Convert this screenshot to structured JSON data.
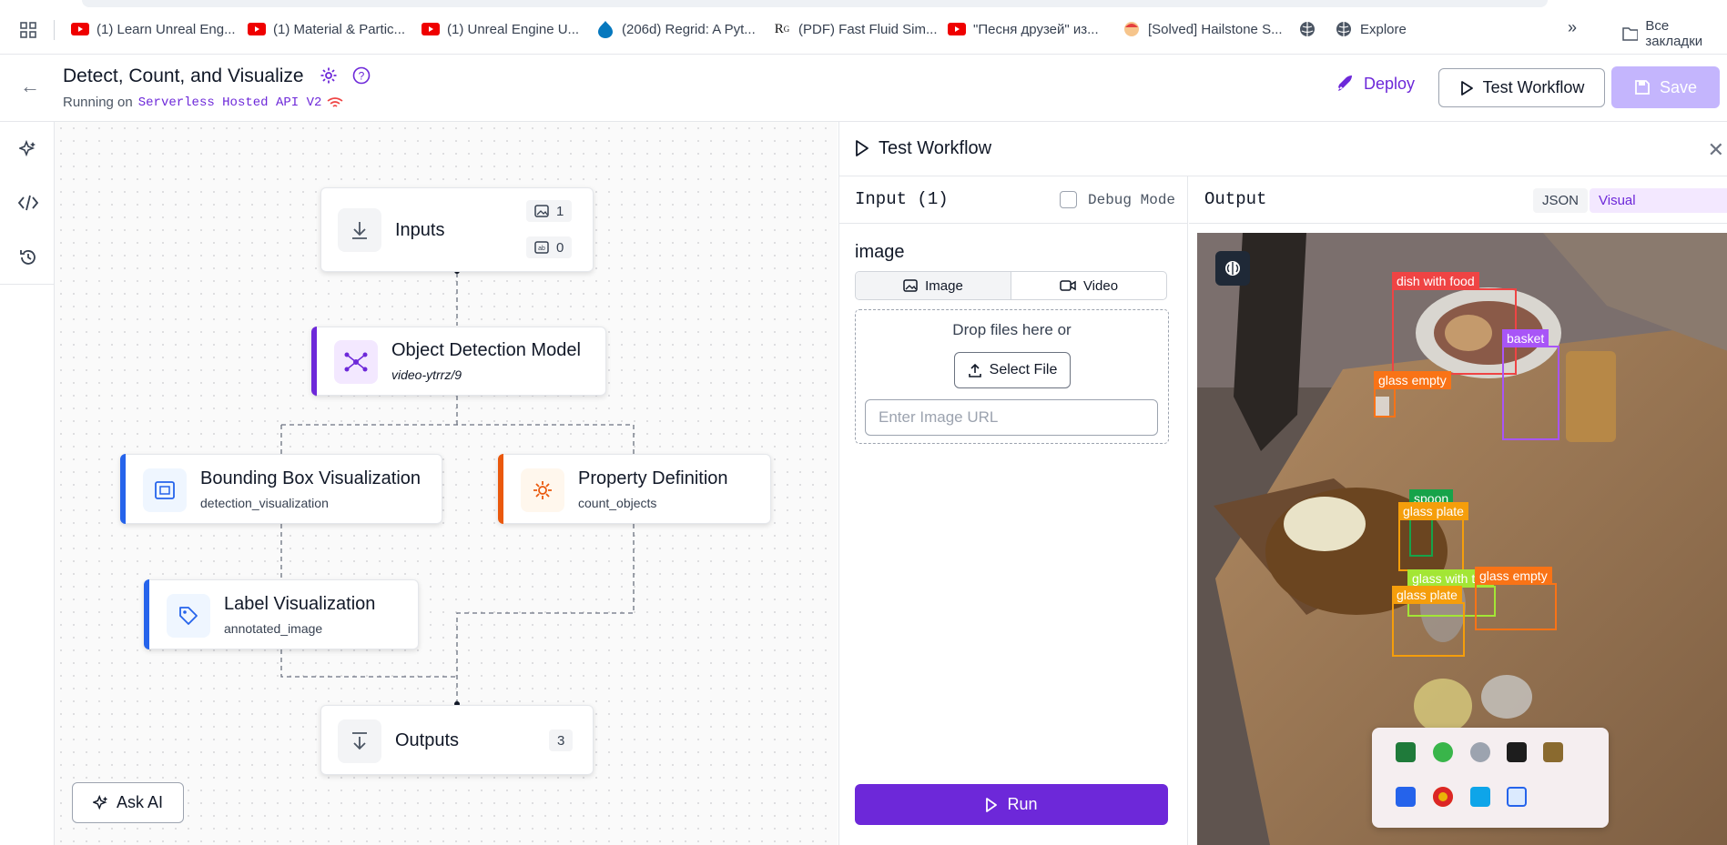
{
  "bookmarks": [
    {
      "label": "(1) Learn Unreal Eng...",
      "icon": "youtube-icon"
    },
    {
      "label": "(1) Material & Partic...",
      "icon": "youtube-icon"
    },
    {
      "label": "(1) Unreal Engine U...",
      "icon": "youtube-icon"
    },
    {
      "label": "(206d) Regrid: A Pyt...",
      "icon": "drupal-icon"
    },
    {
      "label": "(PDF) Fast Fluid Sim...",
      "icon": "researchgate-icon"
    },
    {
      "label": "\"Песня друзей\" из...",
      "icon": "youtube-icon"
    },
    {
      "label": "[Solved] Hailstone S...",
      "icon": "avatar-icon"
    },
    {
      "label": "",
      "icon": "globe-icon"
    },
    {
      "label": "Explore",
      "icon": "globe-icon"
    }
  ],
  "bookmarks_more": "»",
  "bookmarks_folder": "Все закладки",
  "header": {
    "title": "Detect, Count, and Visualize",
    "running_prefix": "Running on",
    "running_target": "Serverless Hosted API V2",
    "deploy_label": "Deploy",
    "test_label": "Test Workflow",
    "save_label": "Save"
  },
  "nodes": {
    "inputs": {
      "title": "Inputs",
      "image_count": "1",
      "param_count": "0"
    },
    "detection": {
      "title": "Object Detection Model",
      "subtitle": "video-ytrrz/9",
      "accent": "#6d28d9"
    },
    "bbox": {
      "title": "Bounding Box Visualization",
      "subtitle": "detection_visualization",
      "accent": "#2563eb"
    },
    "property": {
      "title": "Property Definition",
      "subtitle": "count_objects",
      "accent": "#ea580c"
    },
    "label": {
      "title": "Label Visualization",
      "subtitle": "annotated_image",
      "accent": "#2563eb"
    },
    "outputs": {
      "title": "Outputs",
      "count": "3"
    }
  },
  "ask_ai_label": "Ask AI",
  "test_panel": {
    "title": "Test Workflow",
    "input_header": "Input (1)",
    "debug_label": "Debug Mode",
    "debug_checked": false,
    "field_name": "image",
    "tabs": [
      "Image",
      "Video"
    ],
    "active_tab": "Image",
    "drop_text": "Drop files here or",
    "select_file_label": "Select File",
    "url_placeholder": "Enter Image URL",
    "run_label": "Run",
    "output_header": "Output",
    "output_tabs": [
      "JSON",
      "Visual"
    ],
    "active_output_tab": "Visual"
  },
  "detections": [
    {
      "label": "dish with food",
      "color": "#ef4444"
    },
    {
      "label": "basket",
      "color": "#a855f7"
    },
    {
      "label": "glass empty",
      "color": "#f97316"
    },
    {
      "label": "spoon",
      "color": "#16a34a"
    },
    {
      "label": "glass plate",
      "color": "#f59e0b"
    },
    {
      "label": "glass with tea",
      "color": "#a3e635"
    },
    {
      "label": "glass empty",
      "color": "#f97316"
    },
    {
      "label": "glass plate",
      "color": "#f59e0b"
    }
  ]
}
